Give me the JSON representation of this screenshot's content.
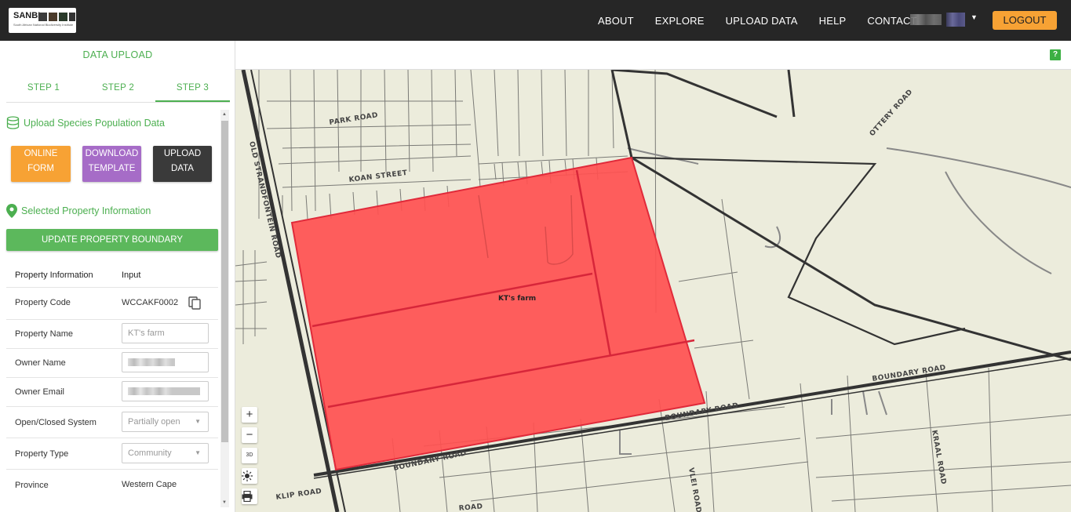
{
  "header": {
    "logo_text": "SANBI",
    "logo_subtext": "South African National Biodiversity Institute",
    "nav": [
      "ABOUT",
      "EXPLORE",
      "UPLOAD DATA",
      "HELP",
      "CONTACT"
    ],
    "logout_label": "LOGOUT",
    "colors": {
      "bar": "#262626",
      "logout": "#f7a234"
    }
  },
  "sidebar": {
    "title": "DATA UPLOAD",
    "steps": [
      {
        "label": "STEP 1",
        "active": false
      },
      {
        "label": "STEP 2",
        "active": false
      },
      {
        "label": "STEP 3",
        "active": true
      }
    ],
    "upload_heading": "Upload Species Population Data",
    "buttons": {
      "online_form": [
        "ONLINE",
        "FORM"
      ],
      "download_template": [
        "DOWNLOAD",
        "TEMPLATE"
      ],
      "upload_data": [
        "UPLOAD",
        "DATA"
      ]
    },
    "property_heading": "Selected Property Information",
    "update_boundary_label": "UPDATE PROPERTY BOUNDARY",
    "table": {
      "col_label": "Property Information",
      "col_input": "Input",
      "property_code": {
        "label": "Property Code",
        "value": "WCCAKF0002"
      },
      "property_name": {
        "label": "Property Name",
        "placeholder": "KT's farm"
      },
      "owner_name": {
        "label": "Owner Name"
      },
      "owner_email": {
        "label": "Owner Email"
      },
      "open_closed": {
        "label": "Open/Closed System",
        "value": "Partially open"
      },
      "property_type": {
        "label": "Property Type",
        "value": "Community"
      },
      "province": {
        "label": "Province",
        "value": "Western Cape"
      }
    },
    "accent": "#4caf50"
  },
  "map": {
    "polygon_label": "KT's farm",
    "polygon_color": "#ff5050",
    "road_labels": {
      "park_road": "PARK ROAD",
      "koan_street": "KOAN STREET",
      "old_strandfontein": "OLD STRANDFONTEIN ROAD",
      "ottery_road": "OTTERY ROAD",
      "boundary_road_1": "BOUNDARY ROAD",
      "boundary_road_2": "BOUNDARY ROAD",
      "boundary_road_3": "BOUNDARY ROAD",
      "vlei_road": "VLEI ROAD",
      "kraal_road": "KRAAL ROAD",
      "klip_road": "KLIP ROAD",
      "partial_road": "ROAD"
    },
    "controls": {
      "zoom_in": "+",
      "zoom_out": "−",
      "three_d": "3D"
    },
    "help": "?"
  }
}
